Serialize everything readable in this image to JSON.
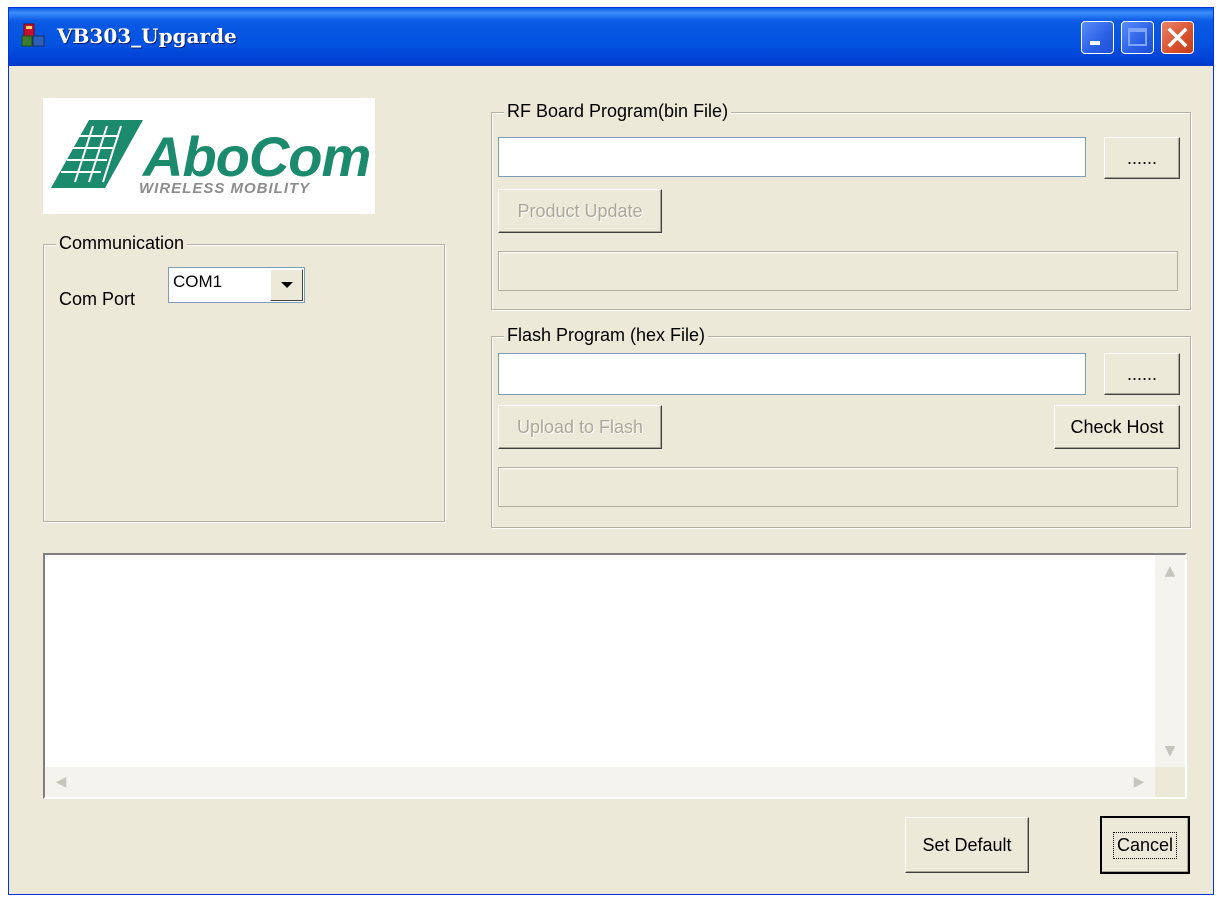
{
  "window": {
    "title": "VB303_Upgarde"
  },
  "logo": {
    "brand": "AboCom",
    "tagline": "WIRELESS MOBILITY"
  },
  "communication": {
    "group_label": "Communication",
    "com_port_label": "Com Port",
    "com_port_value": "COM1"
  },
  "rf_board": {
    "group_label": "RF Board Program(bin File)",
    "file_path": "",
    "browse_label": "......",
    "product_update_label": "Product Update"
  },
  "flash": {
    "group_label": "Flash Program (hex File)",
    "file_path": "",
    "browse_label": "......",
    "upload_label": "Upload to Flash",
    "check_host_label": "Check Host"
  },
  "log": {
    "text": ""
  },
  "footer": {
    "set_default_label": "Set Default",
    "cancel_label": "Cancel"
  },
  "colors": {
    "titlebar": "#0453e1",
    "window_bg": "#ece9d8",
    "logo_green": "#1c8a6c"
  },
  "icons": [
    "app-icon",
    "minimize-icon",
    "maximize-icon",
    "close-icon",
    "dropdown-arrow-icon",
    "scroll-up-icon",
    "scroll-down-icon",
    "scroll-left-icon",
    "scroll-right-icon"
  ]
}
